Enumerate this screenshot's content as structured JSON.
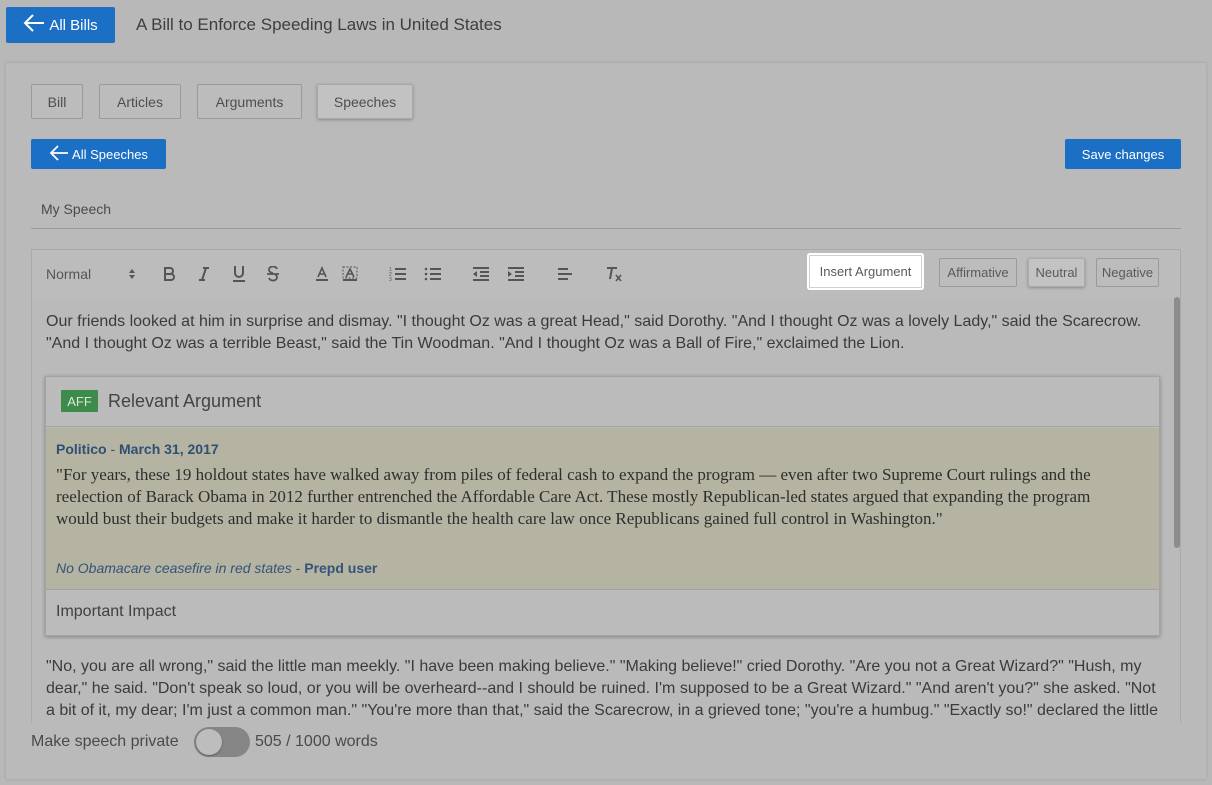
{
  "header": {
    "back_label": "All Bills",
    "bill_title": "A Bill to Enforce Speeding Laws in United States"
  },
  "tabs": [
    {
      "label": "Bill",
      "active": false
    },
    {
      "label": "Articles",
      "active": false
    },
    {
      "label": "Arguments",
      "active": false
    },
    {
      "label": "Speeches",
      "active": true
    }
  ],
  "actions": {
    "all_speeches_label": "All Speeches",
    "save_label": "Save changes"
  },
  "speech": {
    "name": "My Speech"
  },
  "toolbar": {
    "heading_value": "Normal",
    "format_icons": [
      "bold-icon",
      "italic-icon",
      "underline-icon",
      "strikethrough-icon",
      "text-color-icon",
      "highlight-icon",
      "ordered-list-icon",
      "bullet-list-icon",
      "outdent-icon",
      "indent-icon",
      "align-icon",
      "clear-format-icon"
    ],
    "insert_argument_label": "Insert Argument",
    "positions": [
      {
        "label": "Affirmative",
        "active": false
      },
      {
        "label": "Neutral",
        "active": true
      },
      {
        "label": "Negative",
        "active": false
      }
    ]
  },
  "editor": {
    "paragraph_1": "Our friends looked at him in surprise and dismay. \"I thought Oz was a great Head,\" said Dorothy. \"And I thought Oz was a lovely Lady,\" said the Scarecrow. \"And I thought Oz was a terrible Beast,\" said the Tin Woodman. \"And I thought Oz was a Ball of Fire,\" exclaimed the Lion.",
    "argument": {
      "badge": "AFF",
      "title": "Relevant Argument",
      "publication": "Politico",
      "separator": " - ",
      "date": "March 31, 2017",
      "quote": "\"For years, these 19 holdout states have walked away from piles of federal cash to expand the program — even after two Supreme Court rulings and the reelection of Barack Obama in 2012 further entrenched the Affordable Care Act. These mostly Republican-led states argued that expanding the program would bust their budgets and make it harder to dismantle the health care law once Republicans gained full control in Washington.\"",
      "source_title": "No Obamacare ceasefire in red states",
      "source_user": "Prepd user",
      "impact": "Important Impact"
    },
    "paragraph_2": "\"No, you are all wrong,\" said the little man meekly. \"I have been making believe.\" \"Making believe!\" cried Dorothy. \"Are you not a Great Wizard?\" \"Hush, my dear,\" he said. \"Don't speak so loud, or you will be overheard--and I should be ruined. I'm supposed to be a Great Wizard.\" \"And aren't you?\" she asked. \"Not a bit of it, my dear; I'm just a common man.\" \"You're more than that,\" said the Scarecrow, in a grieved tone; \"you're a humbug.\" \"Exactly so!\" declared the little"
  },
  "footer": {
    "private_label": "Make speech private",
    "private_on": false,
    "word_count": "505 / 1000 words"
  },
  "colors": {
    "primary": "#1b6fc4",
    "aff_badge": "#3d8a4a",
    "evidence_bg": "#b5b3a2"
  }
}
